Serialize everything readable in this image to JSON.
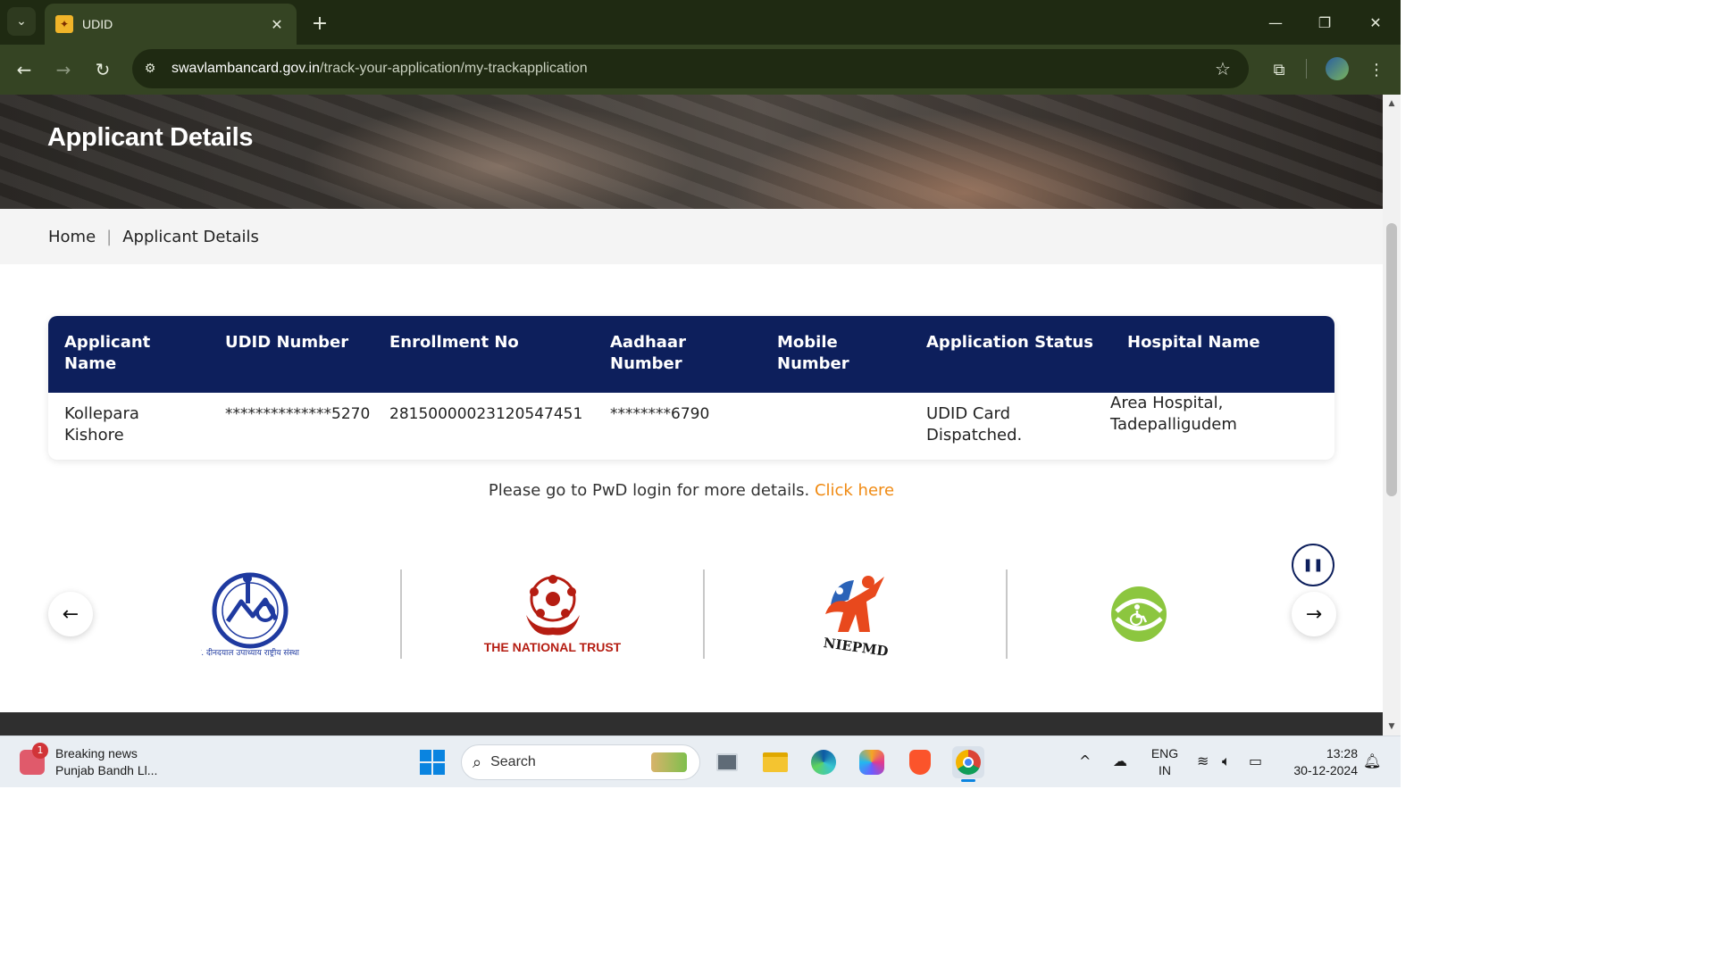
{
  "browser": {
    "tab_title": "UDID",
    "url_domain": "swavlambancard.gov.in",
    "url_path": "/track-your-application/my-trackapplication"
  },
  "page": {
    "banner_title": "Applicant Details",
    "breadcrumb": {
      "home": "Home",
      "separator": "|",
      "current": "Applicant Details"
    },
    "table": {
      "headers": [
        "Applicant Name",
        "UDID Number",
        "Enrollment No",
        "Aadhaar Number",
        "Mobile Number",
        "Application Status",
        "Hospital Name"
      ],
      "row": {
        "applicant_name": "Kollepara Kishore",
        "udid_number": "**************5270",
        "enrollment_no": "281500000231205474​51",
        "aadhaar_number": "********6790",
        "mobile_number": "",
        "application_status": "UDID Card Dispatched.",
        "hospital_name": "Area Hospital, Tadepalligudem"
      }
    },
    "more_details_text": "Please go to PwD login for more details.",
    "more_details_link": "Click here",
    "partner_logos": {
      "nirtar_caption": "पं. दीनदयाल उपाध्याय राष्ट्रीय संस्थान",
      "national_trust_caption": "THE NATIONAL TRUST",
      "niepmd_caption": "NIEPMD"
    },
    "colors": {
      "header_navy": "#0d1f5c",
      "link_orange": "#f08a12"
    }
  },
  "taskbar": {
    "news_badge": "1",
    "news_title": "Breaking news",
    "news_subtitle": "Punjab Bandh Ll...",
    "search_label": "Search",
    "lang_top": "ENG",
    "lang_bottom": "IN",
    "time": "13:28",
    "date": "30-12-2024"
  }
}
